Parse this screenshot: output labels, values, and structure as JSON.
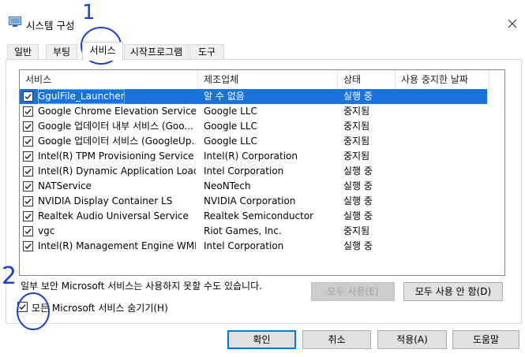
{
  "window": {
    "title": "시스템 구성",
    "close_glyph": "✕"
  },
  "tabs": [
    {
      "label": "일반"
    },
    {
      "label": "부팅"
    },
    {
      "label": "서비스"
    },
    {
      "label": "시작프로그램"
    },
    {
      "label": "도구"
    }
  ],
  "services": {
    "columns": [
      "서비스",
      "제조업체",
      "상태",
      "사용 중지한 날짜"
    ],
    "sort_glyph": "^",
    "rows": [
      {
        "name": "GgulFile_Launcher",
        "vendor": "알 수 없음",
        "status": "실행 중",
        "checked": true,
        "selected": true
      },
      {
        "name": "Google Chrome Elevation Service (...",
        "vendor": "Google LLC",
        "status": "중지됨",
        "checked": true
      },
      {
        "name": "Google 업데이터 내부 서비스 (Goo...",
        "vendor": "Google LLC",
        "status": "중지됨",
        "checked": true
      },
      {
        "name": "Google 업데이터 서비스 (GoogleUp...",
        "vendor": "Google LLC",
        "status": "중지됨",
        "checked": true
      },
      {
        "name": "Intel(R) TPM Provisioning Service",
        "vendor": "Intel(R) Corporation",
        "status": "중지됨",
        "checked": true
      },
      {
        "name": "Intel(R) Dynamic Application Loade...",
        "vendor": "Intel Corporation",
        "status": "실행 중",
        "checked": true
      },
      {
        "name": "NATService",
        "vendor": "NeoNTech",
        "status": "실행 중",
        "checked": true
      },
      {
        "name": "NVIDIA Display Container LS",
        "vendor": "NVIDIA Corporation",
        "status": "실행 중",
        "checked": true
      },
      {
        "name": "Realtek Audio Universal Service",
        "vendor": "Realtek Semiconductor",
        "status": "실행 중",
        "checked": true
      },
      {
        "name": "vgc",
        "vendor": "Riot Games, Inc.",
        "status": "중지됨",
        "checked": true
      },
      {
        "name": "Intel(R) Management Engine WMI P...",
        "vendor": "Intel Corporation",
        "status": "실행 중",
        "checked": true
      }
    ]
  },
  "footer": {
    "note": "일부 보안 Microsoft 서비스는 사용하지 못할 수도 있습니다.",
    "enable_all": "모두 사용(E)",
    "disable_all": "모두 사용 안 함(D)",
    "hide_ms_label": "모든 Microsoft 서비스 숨기기(H)",
    "hide_ms_checked": true
  },
  "buttons": {
    "ok": "확인",
    "cancel": "취소",
    "apply": "적용(A)",
    "help": "도움말"
  },
  "annotations": {
    "mark_1": "1",
    "mark_2": "2",
    "ink_color": "#1a3fd8"
  },
  "colors": {
    "selection": "#1a73d9",
    "default_button_border": "#0078d7"
  }
}
